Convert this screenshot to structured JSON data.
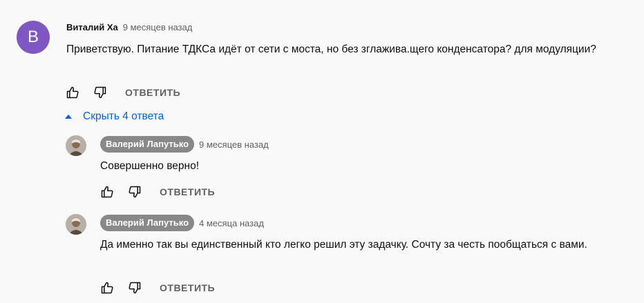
{
  "comment": {
    "avatar_letter": "В",
    "author": "Виталий Ха",
    "time": "9 месяцев назад",
    "text": "Приветствую. Питание ТДКСа идёт от сети с моста, но без зглажива.щего конденсатора? для модуляции?",
    "reply_label": "ОТВЕТИТЬ"
  },
  "replies_toggle": {
    "label": "Скрыть 4 ответа"
  },
  "replies": [
    {
      "author": "Валерий Лапутько",
      "time": "9 месяцев назад",
      "text": "Совершенно верно!",
      "reply_label": "ОТВЕТИТЬ"
    },
    {
      "author": "Валерий Лапутько",
      "time": "4 месяца назад",
      "text": "Да именно так вы единственный кто легко решил эту задачку. Сочту за честь пообщаться с вами.",
      "reply_label": "ОТВЕТИТЬ"
    }
  ],
  "colors": {
    "avatar_bg": "#7e57c2",
    "link": "#065fd4",
    "pill_bg": "#888888",
    "secondary_text": "#606060"
  },
  "icons": {
    "like": "thumb-up-icon",
    "dislike": "thumb-down-icon",
    "toggle": "caret-up-icon"
  }
}
